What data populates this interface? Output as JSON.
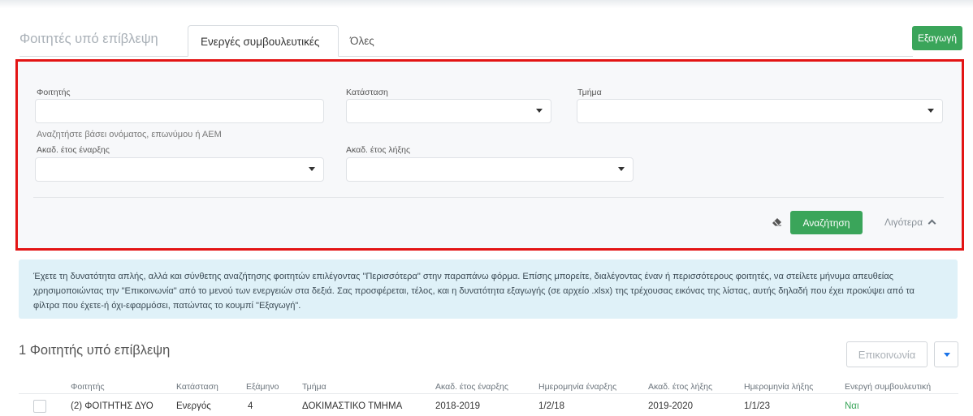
{
  "header": {
    "title": "Φοιτητές υπό επίβλεψη",
    "tabs": [
      {
        "label": "Ενεργές συμβουλευτικές",
        "active": true
      },
      {
        "label": "Όλες",
        "active": false
      }
    ],
    "export_label": "Εξαγωγή"
  },
  "filters": {
    "student_label": "Φοιτητής",
    "student_value": "",
    "student_hint": "Αναζητήστε βάσει ονόματος, επωνύμου ή ΑΕΜ",
    "status_label": "Κατάσταση",
    "status_value": "",
    "department_label": "Τμήμα",
    "department_value": "",
    "start_year_label": "Ακαδ. έτος έναρξης",
    "start_year_value": "",
    "end_year_label": "Ακαδ. έτος λήξης",
    "end_year_value": "",
    "search_label": "Αναζήτηση",
    "less_label": "Λιγότερα",
    "clear_icon": "eraser-icon"
  },
  "info_text": "Έχετε τη δυνατότητα απλής, αλλά και σύνθετης αναζήτησης φοιτητών επιλέγοντας \"Περισσότερα\" στην παραπάνω φόρμα. Επίσης μπορείτε, διαλέγοντας έναν ή περισσότερους φοιτητές, να στείλετε μήνυμα απευθείας χρησιμοποιώντας την \"Επικοινωνία\" από το μενού των ενεργειών στα δεξιά. Σας προσφέρεται, τέλος, και η δυνατότητα εξαγωγής (σε αρχείο .xlsx) της τρέχουσας εικόνας της λίστας, αυτής δηλαδή που έχει προκύψει από τα φίλτρα που έχετε-ή όχι-εφαρμόσει, πατώντας το κουμπί \"Εξαγωγή\".",
  "list": {
    "count_title": "1 Φοιτητής υπό επίβλεψη",
    "contact_label": "Επικοινωνία",
    "columns": [
      "Φοιτητής",
      "Κατάσταση",
      "Εξάμηνο",
      "Τμήμα",
      "Ακαδ. έτος έναρξης",
      "Ημερομηνία έναρξης",
      "Ακαδ. έτος λήξης",
      "Ημερομηνία λήξης",
      "Ενεργή συμβουλευτική"
    ],
    "rows": [
      [
        "(2) ΦΟΙΤΗΤΗΣ ΔΥΟ",
        "Ενεργός",
        "4",
        "ΔΟΚΙΜΑΣΤΙΚΟ ΤΜΗΜΑ",
        "2018-2019",
        "1/2/18",
        "2019-2020",
        "1/1/23",
        "Ναι"
      ]
    ]
  },
  "colors": {
    "accent_green": "#3aa55a",
    "highlight_red": "#e31414",
    "info_bg": "#dff1f8"
  }
}
